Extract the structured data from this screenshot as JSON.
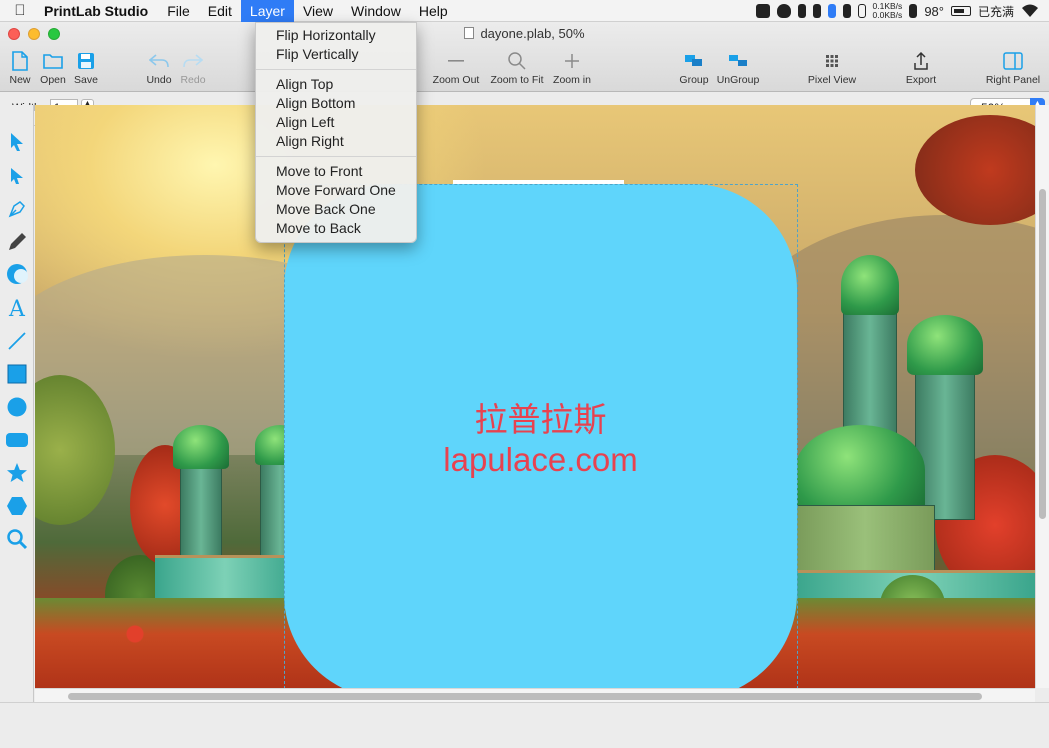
{
  "menubar": {
    "app_name": "PrintLab Studio",
    "items": [
      "File",
      "Edit",
      "Layer",
      "View",
      "Window",
      "Help"
    ],
    "active": "Layer"
  },
  "status": {
    "net_up": "0.1KB/s",
    "net_down": "0.0KB/s",
    "temp": "98°",
    "battery": "已充满"
  },
  "window": {
    "title": "dayone.plab, 50%"
  },
  "toolbar": {
    "new": "New",
    "open": "Open",
    "save": "Save",
    "undo": "Undo",
    "redo": "Redo",
    "zoom_out": "Zoom Out",
    "zoom_fit": "Zoom to Fit",
    "zoom_in": "Zoom in",
    "group": "Group",
    "ungroup": "UnGroup",
    "pixel_view": "Pixel View",
    "export": "Export",
    "right_panel": "Right Panel"
  },
  "options": {
    "width_label": "Width:",
    "width_value": "1",
    "zoom_value": "50%"
  },
  "layer_menu": {
    "group1": [
      "Flip Horizontally",
      "Flip Vertically"
    ],
    "group2": [
      "Align Top",
      "Align Bottom",
      "Align Left",
      "Align Right"
    ],
    "group3": [
      "Move to Front",
      "Move Forward One",
      "Move Back One",
      "Move to Back"
    ]
  },
  "canvas": {
    "text_cn": "拉普拉斯",
    "text_en": "lapulace.com",
    "shape_color": "#5fd5fb",
    "text_color": "#e8424f"
  },
  "colors": {
    "accent": "#2f7cf6",
    "tool_blue": "#1aa0e8"
  }
}
